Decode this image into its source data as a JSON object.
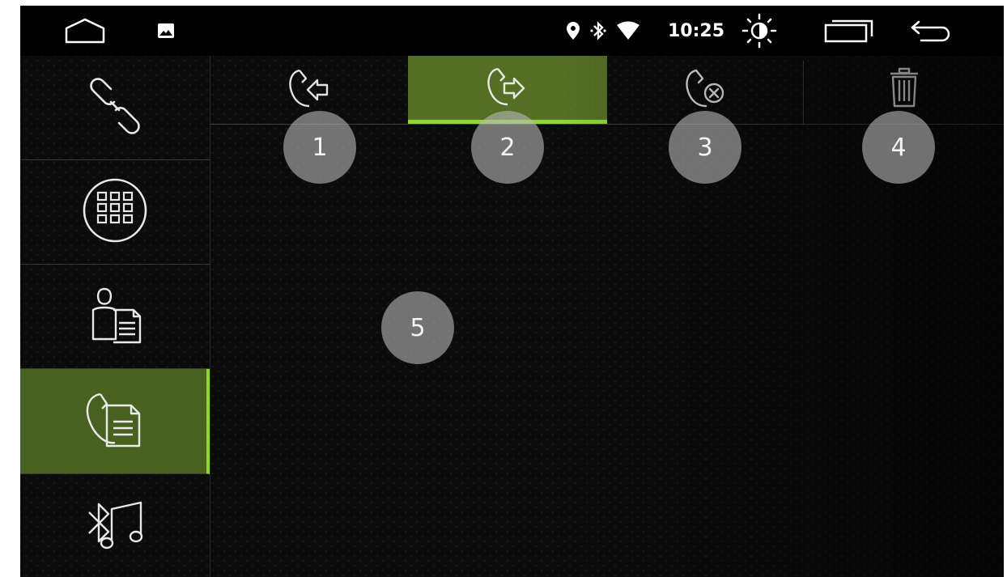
{
  "statusbar": {
    "clock": "10:25",
    "icons": [
      "home-icon",
      "gallery-icon",
      "location-icon",
      "bluetooth-icon",
      "wifi-icon",
      "brightness-icon",
      "recent-apps-icon",
      "back-icon"
    ]
  },
  "sidebar": {
    "items": [
      {
        "icon": "link-icon",
        "active": false
      },
      {
        "icon": "dialpad-icon",
        "active": false
      },
      {
        "icon": "contacts-icon",
        "active": false
      },
      {
        "icon": "call-log-icon",
        "active": true
      },
      {
        "icon": "bluetooth-music-icon",
        "active": false
      }
    ]
  },
  "tabs": [
    {
      "icon": "incoming-call-icon",
      "active": false
    },
    {
      "icon": "outgoing-call-icon",
      "active": true
    },
    {
      "icon": "missed-call-icon",
      "active": false
    },
    {
      "icon": "delete-icon",
      "active": false
    }
  ],
  "callouts": [
    "1",
    "2",
    "3",
    "4",
    "5"
  ],
  "colors": {
    "accent": "#8fd43a",
    "active_bg": "#5f822a",
    "background": "#050505",
    "callout": "#b9b9b9"
  }
}
